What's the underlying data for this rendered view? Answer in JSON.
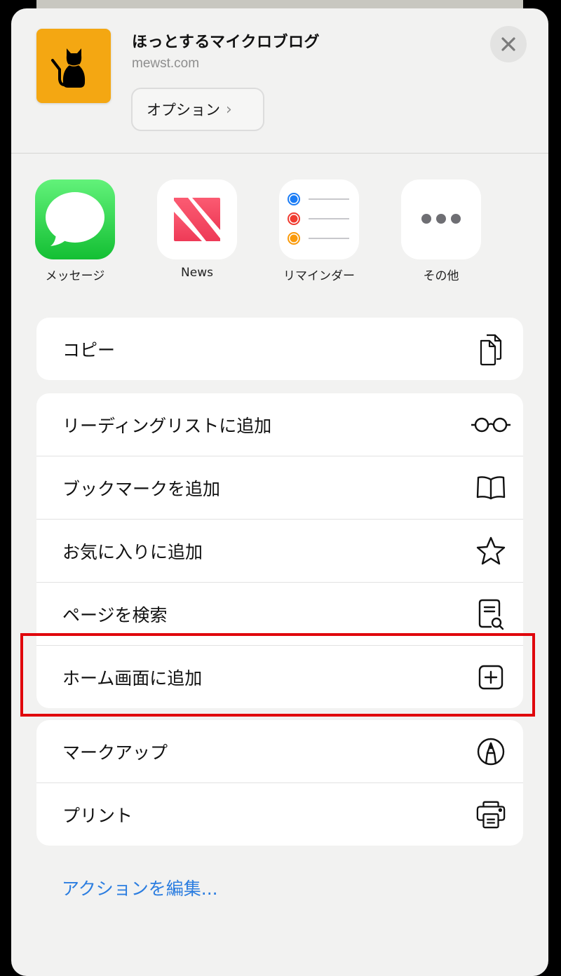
{
  "header": {
    "title": "ほっとするマイクロブログ",
    "domain": "mewst.com",
    "options_label": "オプション",
    "options_chevron": "›",
    "close_icon": "close-icon",
    "app_icon_color": "#f4a712"
  },
  "share_apps": [
    {
      "label": "メッセージ",
      "icon": "messages-icon"
    },
    {
      "label": "News",
      "icon": "news-icon"
    },
    {
      "label": "リマインダー",
      "icon": "reminders-icon"
    },
    {
      "label": "その他",
      "icon": "more-icon"
    }
  ],
  "actions": {
    "group1": [
      {
        "label": "コピー",
        "icon": "copy-icon"
      }
    ],
    "group2": [
      {
        "label": "リーディングリストに追加",
        "icon": "glasses-icon"
      },
      {
        "label": "ブックマークを追加",
        "icon": "book-icon"
      },
      {
        "label": "お気に入りに追加",
        "icon": "star-icon"
      },
      {
        "label": "ページを検索",
        "icon": "find-in-page-icon"
      },
      {
        "label": "ホーム画面に追加",
        "icon": "add-square-icon",
        "highlighted": true
      }
    ],
    "group3": [
      {
        "label": "マークアップ",
        "icon": "markup-icon"
      },
      {
        "label": "プリント",
        "icon": "printer-icon"
      }
    ]
  },
  "edit_actions_label": "アクションを編集...",
  "colors": {
    "highlight": "#e0060c",
    "link": "#2b7de0",
    "messages_green": "#2fcf4f",
    "news_red": "#f04a5f"
  }
}
